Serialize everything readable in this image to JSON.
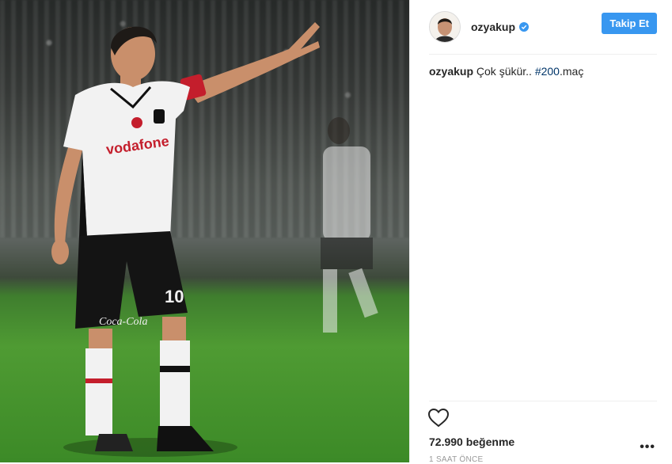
{
  "post": {
    "username": "ozyakup",
    "follow_label": "Takip Et",
    "caption_user": "ozyakup",
    "caption_text": "Çok şükür..",
    "caption_hashtag": "#200",
    "caption_suffix": ".maç",
    "likes": "72.990 beğenme",
    "time": "1 SAAT ÖNCE",
    "more": "•••"
  },
  "colors": {
    "accent": "#3897f0",
    "hashtag": "#003569"
  },
  "icons": [
    "verified-badge-icon",
    "heart-icon",
    "more-options-icon"
  ]
}
